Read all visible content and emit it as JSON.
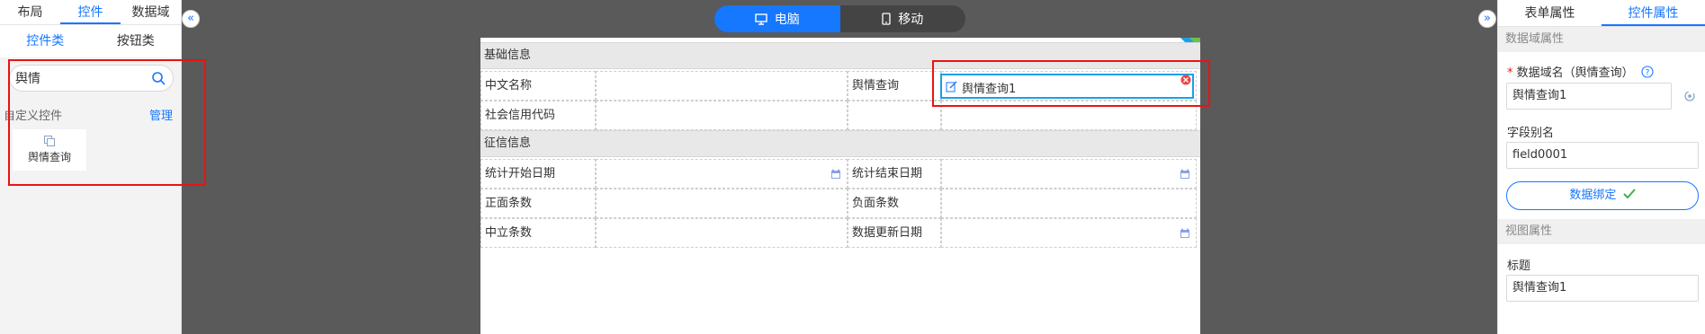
{
  "left_panel": {
    "tabs": [
      {
        "label": "布局"
      },
      {
        "label": "控件"
      },
      {
        "label": "数据域"
      }
    ],
    "sub_tabs": [
      {
        "label": "控件类"
      },
      {
        "label": "按钮类"
      }
    ],
    "search": {
      "value": "舆情"
    },
    "custom_section": {
      "label": "自定义控件",
      "manage": "管理"
    },
    "widgets": [
      {
        "label": "舆情查询",
        "icon": "copy-icon"
      }
    ]
  },
  "collapse": {
    "left": "«",
    "right": "»"
  },
  "device_switch": {
    "pc": {
      "label": "电脑",
      "icon": "monitor-icon"
    },
    "mobile": {
      "label": "移动",
      "icon": "phone-icon"
    }
  },
  "form": {
    "sections": [
      {
        "title": "基础信息"
      },
      {
        "title": "征信信息"
      }
    ],
    "labels": {
      "cn_name": "中文名称",
      "sentiment": "舆情查询",
      "credit_code": "社会信用代码",
      "start_date": "统计开始日期",
      "end_date": "统计结束日期",
      "positive": "正面条数",
      "negative": "负面条数",
      "neutral": "中立条数",
      "update_date": "数据更新日期"
    },
    "active_field": {
      "value": "舆情查询1"
    }
  },
  "right_panel": {
    "tabs": [
      {
        "label": "表单属性"
      },
      {
        "label": "控件属性"
      }
    ],
    "data_section": "数据域属性",
    "datafield_label": "数据域名（舆情查询）",
    "datafield_value": "舆情查询1",
    "alias_label": "字段别名",
    "alias_value": "field0001",
    "bind_button": "数据绑定",
    "view_section": "视图属性",
    "title_label": "标题",
    "title_value": "舆情查询1"
  },
  "colors": {
    "accent": "#1677ff",
    "highlight": "#e11111",
    "active_border": "#19a0e8"
  }
}
